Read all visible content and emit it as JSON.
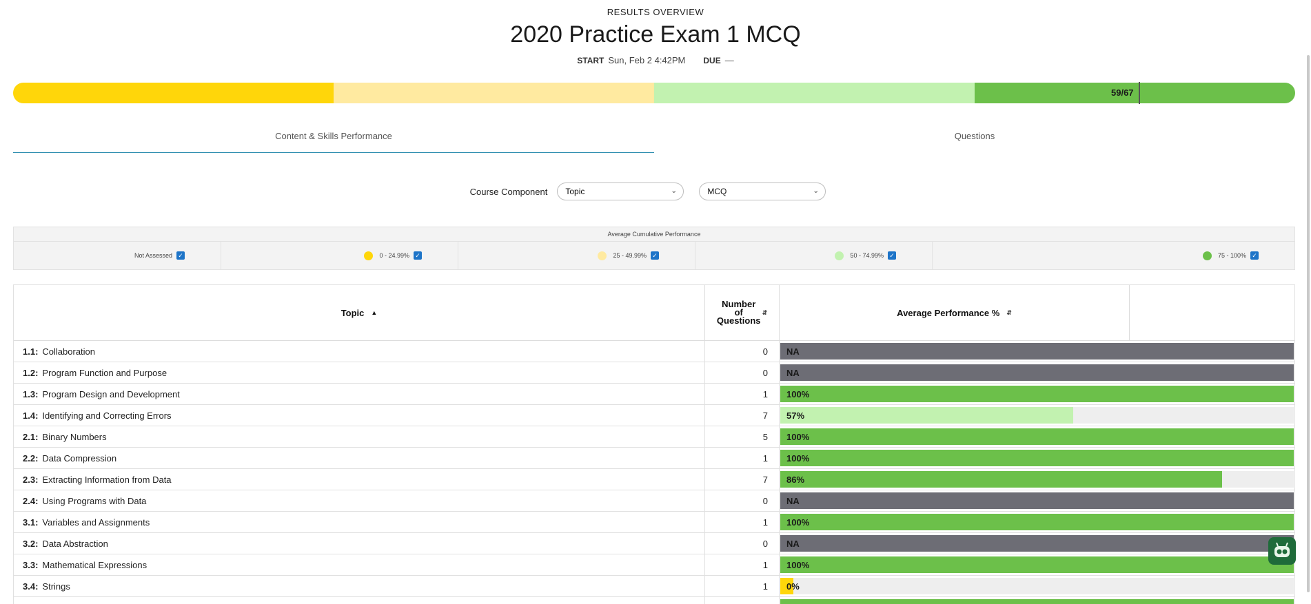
{
  "header": {
    "eyebrow": "RESULTS OVERVIEW",
    "title": "2020 Practice Exam 1 MCQ",
    "start_label": "START",
    "start_value": "Sun, Feb 2 4:42PM",
    "due_label": "DUE",
    "due_value": "—"
  },
  "score": {
    "label": "59/67",
    "segments": [
      "#ffd60a",
      "#ffeaa0",
      "#c2f2b0",
      "#6cc04a"
    ]
  },
  "tabs": [
    {
      "label": "Content & Skills Performance",
      "active": true
    },
    {
      "label": "Questions",
      "active": false
    }
  ],
  "filters": {
    "label": "Course Component",
    "select1": "Topic",
    "select2": "MCQ"
  },
  "legend": {
    "title": "Average Cumulative Performance",
    "items": [
      {
        "label": "Not Assessed",
        "color": ""
      },
      {
        "label": "0 - 24.99%",
        "color": "#ffd60a"
      },
      {
        "label": "25 - 49.99%",
        "color": "#ffeaa0"
      },
      {
        "label": "50 - 74.99%",
        "color": "#c2f2b0"
      },
      {
        "label": "75 - 100%",
        "color": "#6cc04a"
      }
    ]
  },
  "table": {
    "headers": {
      "topic": "Topic",
      "num": "Number of Questions",
      "perf": "Average Performance %"
    },
    "rows": [
      {
        "code": "1.1:",
        "name": "Collaboration",
        "count": "0",
        "perf": "NA",
        "pct": 1.0,
        "color": "#6d6d75"
      },
      {
        "code": "1.2:",
        "name": "Program Function and Purpose",
        "count": "0",
        "perf": "NA",
        "pct": 1.0,
        "color": "#6d6d75"
      },
      {
        "code": "1.3:",
        "name": "Program Design and Development",
        "count": "1",
        "perf": "100%",
        "pct": 1.0,
        "color": "#6cc04a"
      },
      {
        "code": "1.4:",
        "name": "Identifying and Correcting Errors",
        "count": "7",
        "perf": "57%",
        "pct": 0.57,
        "color": "#c2f2b0"
      },
      {
        "code": "2.1:",
        "name": "Binary Numbers",
        "count": "5",
        "perf": "100%",
        "pct": 1.0,
        "color": "#6cc04a"
      },
      {
        "code": "2.2:",
        "name": "Data Compression",
        "count": "1",
        "perf": "100%",
        "pct": 1.0,
        "color": "#6cc04a"
      },
      {
        "code": "2.3:",
        "name": "Extracting Information from Data",
        "count": "7",
        "perf": "86%",
        "pct": 0.86,
        "color": "#6cc04a"
      },
      {
        "code": "2.4:",
        "name": "Using Programs with Data",
        "count": "0",
        "perf": "NA",
        "pct": 1.0,
        "color": "#6d6d75"
      },
      {
        "code": "3.1:",
        "name": "Variables and Assignments",
        "count": "1",
        "perf": "100%",
        "pct": 1.0,
        "color": "#6cc04a"
      },
      {
        "code": "3.2:",
        "name": "Data Abstraction",
        "count": "0",
        "perf": "NA",
        "pct": 1.0,
        "color": "#6d6d75"
      },
      {
        "code": "3.3:",
        "name": "Mathematical Expressions",
        "count": "1",
        "perf": "100%",
        "pct": 1.0,
        "color": "#6cc04a"
      },
      {
        "code": "3.4:",
        "name": "Strings",
        "count": "1",
        "perf": "0%",
        "pct": 0.025,
        "color": "#ffd60a"
      },
      {
        "code": "",
        "name": "",
        "count": "",
        "perf": "",
        "pct": 1.0,
        "color": "#6cc04a"
      }
    ]
  }
}
